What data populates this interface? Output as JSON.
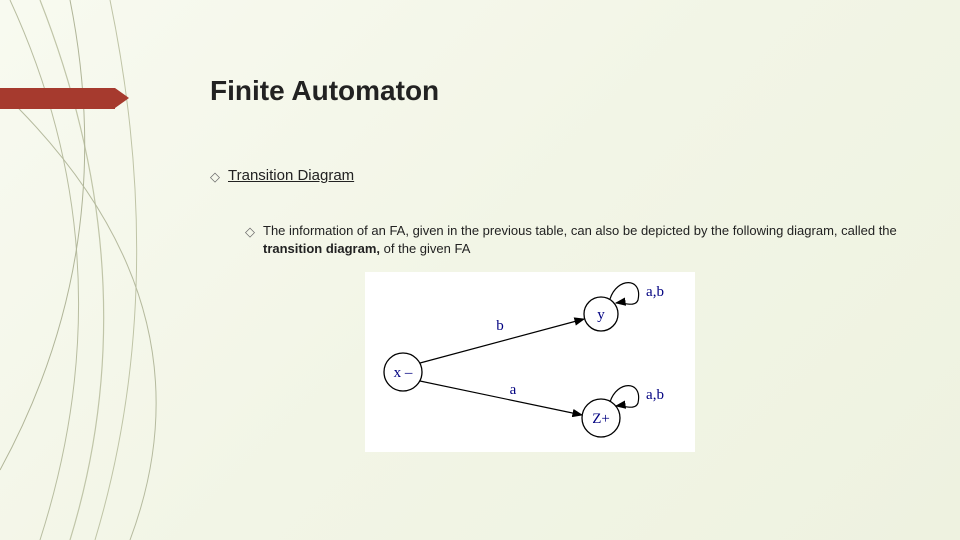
{
  "title": "Finite Automaton",
  "section_label": "Transition Diagram",
  "body_part1": "The information of an FA, given in the previous table, can also be depicted by the following diagram, called the ",
  "body_bold": "transition diagram,",
  "body_part2": " of the given FA",
  "diagram": {
    "states": {
      "x": {
        "label": "x –"
      },
      "y": {
        "label": "y"
      },
      "z": {
        "label": "Z+"
      }
    },
    "edges": [
      {
        "from": "x",
        "to": "y",
        "label": "b"
      },
      {
        "from": "x",
        "to": "z",
        "label": "a"
      },
      {
        "from": "y",
        "to": "y",
        "label": "a,b"
      },
      {
        "from": "z",
        "to": "z",
        "label": "a,b"
      }
    ]
  }
}
